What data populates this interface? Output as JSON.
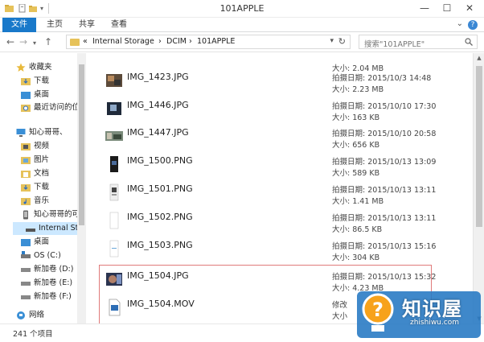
{
  "window": {
    "title": "101APPLE",
    "minimize": "—",
    "maximize": "☐",
    "close": "✕"
  },
  "ribbon": {
    "tabs": [
      "文件",
      "主页",
      "共享",
      "查看"
    ]
  },
  "addressbar": {
    "back": "←",
    "forward": "→",
    "recent": "▾",
    "up": "↑",
    "overflow": "«",
    "crumbs": [
      "Internal Storage",
      "DCIM",
      "101APPLE"
    ],
    "separator": "›",
    "dropdown": "▾",
    "refresh": "↻"
  },
  "search": {
    "placeholder": "搜索\"101APPLE\""
  },
  "navpane": {
    "items": [
      {
        "label": "收藏夹",
        "icon": "star-icon"
      },
      {
        "label": "下载",
        "icon": "download-folder-icon"
      },
      {
        "label": "桌面",
        "icon": "desktop-folder-icon"
      },
      {
        "label": "最近访问的位置",
        "icon": "recent-places-icon"
      },
      {
        "label": "知心哥哥、",
        "icon": "pc-icon"
      },
      {
        "label": "视频",
        "icon": "videos-folder-icon"
      },
      {
        "label": "图片",
        "icon": "pictures-folder-icon"
      },
      {
        "label": "文档",
        "icon": "documents-folder-icon"
      },
      {
        "label": "下载",
        "icon": "download-folder-icon"
      },
      {
        "label": "音乐",
        "icon": "music-folder-icon"
      },
      {
        "label": "知心哥哥的可爱",
        "icon": "device-icon"
      },
      {
        "label": "Internal Stora",
        "icon": "drive-icon"
      },
      {
        "label": "桌面",
        "icon": "desktop-folder-icon"
      },
      {
        "label": "OS (C:)",
        "icon": "os-drive-icon"
      },
      {
        "label": "新加卷 (D:)",
        "icon": "drive-icon"
      },
      {
        "label": "新加卷 (E:)",
        "icon": "drive-icon"
      },
      {
        "label": "新加卷 (F:)",
        "icon": "drive-icon"
      },
      {
        "label": "网络",
        "icon": "network-icon"
      }
    ]
  },
  "files": [
    {
      "name": "",
      "line1": "",
      "line2": "大小: 2.04 MB",
      "thumb": "none"
    },
    {
      "name": "IMG_1423.JPG",
      "line1": "拍摄日期: 2015/10/3 14:48",
      "line2": "大小: 2.23 MB",
      "thumb": "photo"
    },
    {
      "name": "IMG_1446.JPG",
      "line1": "拍摄日期: 2015/10/10 17:30",
      "line2": "大小: 163 KB",
      "thumb": "photo-dark"
    },
    {
      "name": "IMG_1447.JPG",
      "line1": "拍摄日期: 2015/10/10 20:58",
      "line2": "大小: 656 KB",
      "thumb": "photo-street"
    },
    {
      "name": "IMG_1500.PNG",
      "line1": "拍摄日期: 2015/10/13 13:09",
      "line2": "大小: 589 KB",
      "thumb": "screen-dark"
    },
    {
      "name": "IMG_1501.PNG",
      "line1": "拍摄日期: 2015/10/13 13:11",
      "line2": "大小: 1.41 MB",
      "thumb": "screen-light"
    },
    {
      "name": "IMG_1502.PNG",
      "line1": "拍摄日期: 2015/10/13 13:11",
      "line2": "大小: 86.5 KB",
      "thumb": "screen-white"
    },
    {
      "name": "IMG_1503.PNG",
      "line1": "拍摄日期: 2015/10/13 15:16",
      "line2": "大小: 304 KB",
      "thumb": "screen-white"
    },
    {
      "name": "IMG_1504.JPG",
      "line1": "拍摄日期: 2015/10/13 15:32",
      "line2": "大小: 4.23 MB",
      "thumb": "photo-selfie"
    },
    {
      "name": "IMG_1504.MOV",
      "line1": "修改",
      "line2": "大小",
      "thumb": "video"
    }
  ],
  "status": {
    "count": "241 个项目"
  },
  "watermark": {
    "text": "知识屋",
    "sub": "zhishiwu.com"
  },
  "colors": {
    "accent": "#1979ca",
    "highlight_border": "#e07a7a",
    "watermark_bg": "#2a7bc4",
    "folder": "#e6c25a"
  }
}
